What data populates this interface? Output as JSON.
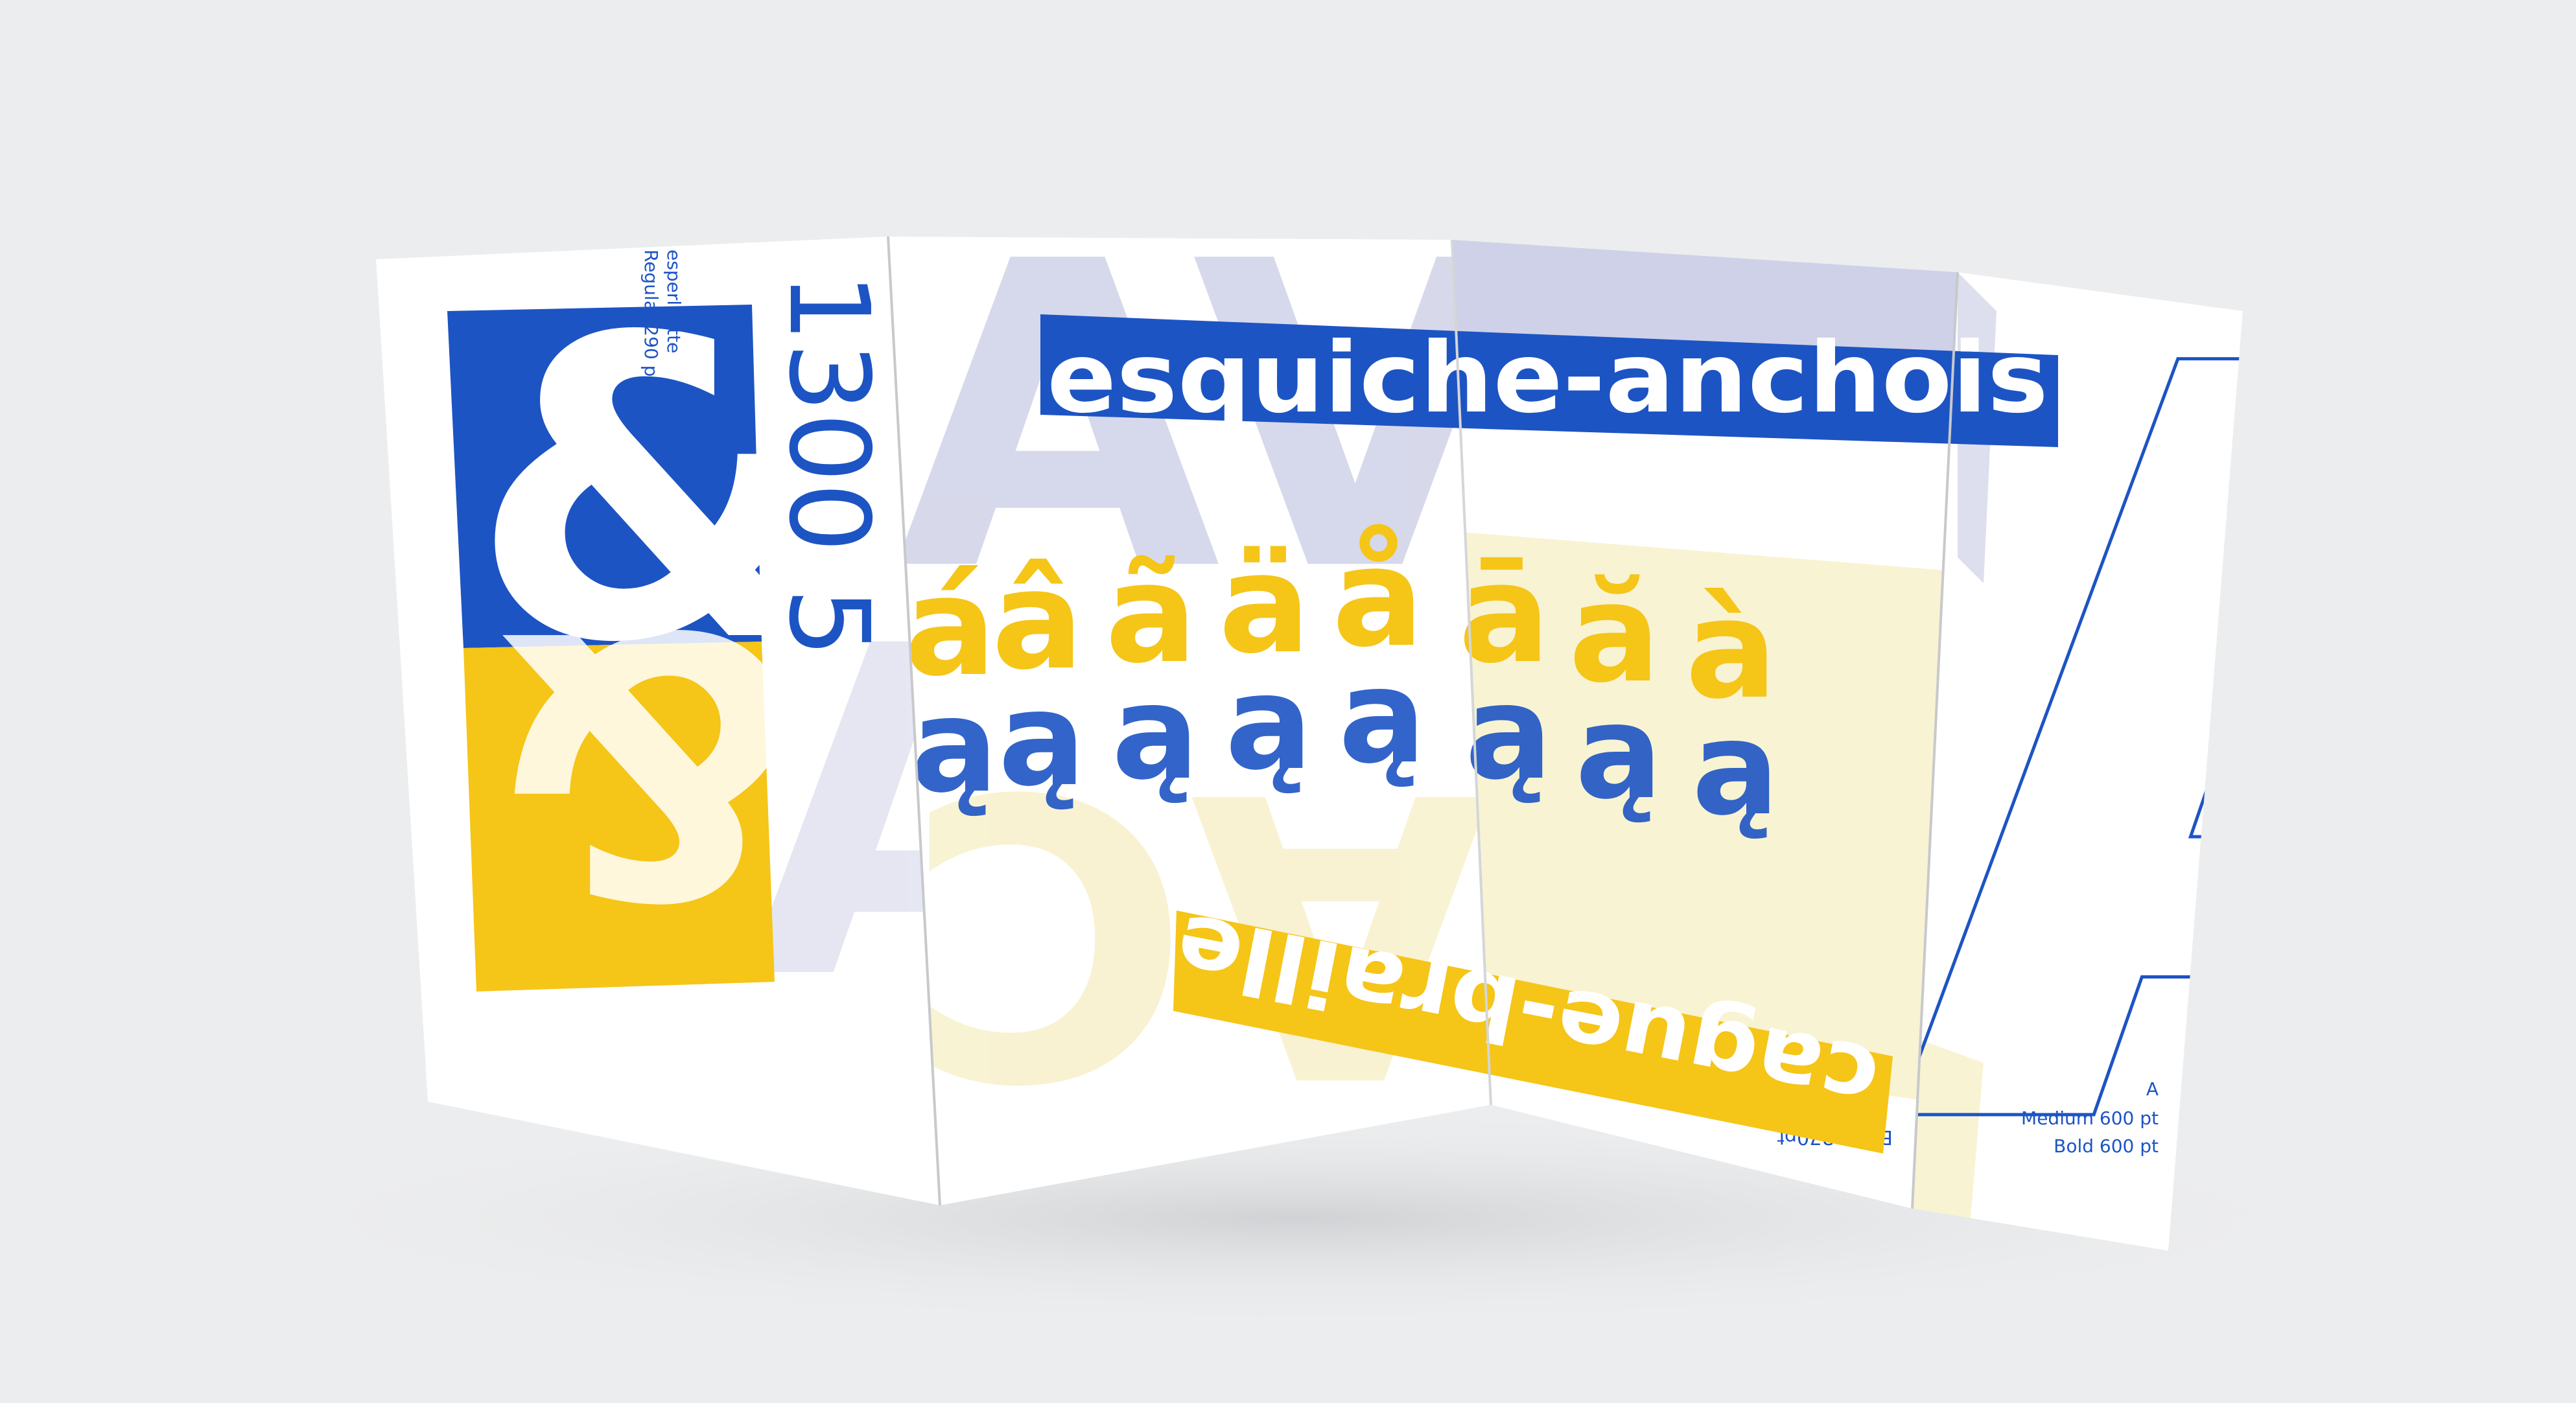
{
  "scene": {
    "colors": {
      "background": "#ecedee",
      "paper": "#ffffff",
      "blue": "#1d54c4",
      "yellow": "#f5c518",
      "lavender": "#c6c9e3",
      "pale_yellow": "#f4ebb5"
    },
    "panel1": {
      "ampersand": "&",
      "number": "1300 5",
      "caption": "esperluette",
      "caption_size": "Regular 290 pt",
      "ghost_letters": "AVA"
    },
    "panel2": {
      "banner": "esquiche-anchois",
      "accented_glyphs": [
        "á",
        "â",
        "ã",
        "ä",
        "å",
        "ā",
        "ă",
        "à"
      ],
      "base_glyphs": [
        "ą",
        "ą",
        "ą",
        "ą",
        "ą",
        "ą",
        "ą",
        "ą"
      ],
      "ghost_top": "AVAE",
      "ghost_bottom": "ACH"
    },
    "panel3": {
      "banner": "cague-braille",
      "size_label": "Black 270pt"
    },
    "panel4": {
      "letter": "A",
      "label_a": "A",
      "label_medium": "Medium 600 pt",
      "label_bold": "Bold 600 pt"
    }
  }
}
